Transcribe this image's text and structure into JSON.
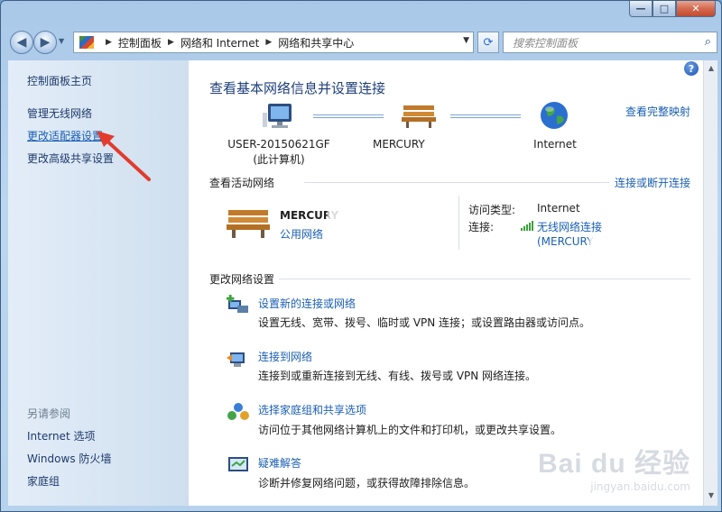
{
  "window": {
    "caption": {
      "minimize": "—",
      "maximize": "□",
      "close": "✕"
    }
  },
  "address": {
    "breadcrumbs": [
      "控制面板",
      "网络和 Internet",
      "网络和共享中心"
    ],
    "search_placeholder": "搜索控制面板"
  },
  "sidebar": {
    "home": "控制面板主页",
    "items": [
      "管理无线网络",
      "更改适配器设置",
      "更改高级共享设置"
    ],
    "see_also_heading": "另请参阅",
    "see_also": [
      "Internet 选项",
      "Windows 防火墙",
      "家庭组"
    ]
  },
  "main": {
    "title": "查看基本网络信息并设置连接",
    "full_map": "查看完整映射",
    "nodes": [
      {
        "name": "USER-20150621GF",
        "sub": "(此计算机)"
      },
      {
        "name": "MERCURY",
        "sub": ""
      },
      {
        "name": "Internet",
        "sub": ""
      }
    ],
    "active_heading": "查看活动网络",
    "connect_disconnect": "连接或断开连接",
    "active_network": {
      "name": "MERCURY",
      "type": "公用网络",
      "access_label": "访问类型:",
      "access_value": "Internet",
      "connection_label": "连接:",
      "connection_value": "无线网络连接",
      "connection_ssid": "(MERCURY"
    },
    "change_heading": "更改网络设置",
    "tasks": [
      {
        "title": "设置新的连接或网络",
        "desc": "设置无线、宽带、拨号、临时或 VPN 连接；或设置路由器或访问点。"
      },
      {
        "title": "连接到网络",
        "desc": "连接到或重新连接到无线、有线、拨号或 VPN 网络连接。"
      },
      {
        "title": "选择家庭组和共享选项",
        "desc": "访问位于其他网络计算机上的文件和打印机，或更改共享设置。"
      },
      {
        "title": "疑难解答",
        "desc": "诊断并修复网络问题，或获得故障排除信息。"
      }
    ]
  },
  "watermark": {
    "brand": "Bai du 经验",
    "url": "jingyan.baidu.com"
  },
  "colors": {
    "link": "#1a5fb4",
    "title": "#1e3f7a",
    "annotation_arrow": "#e23b2e"
  }
}
